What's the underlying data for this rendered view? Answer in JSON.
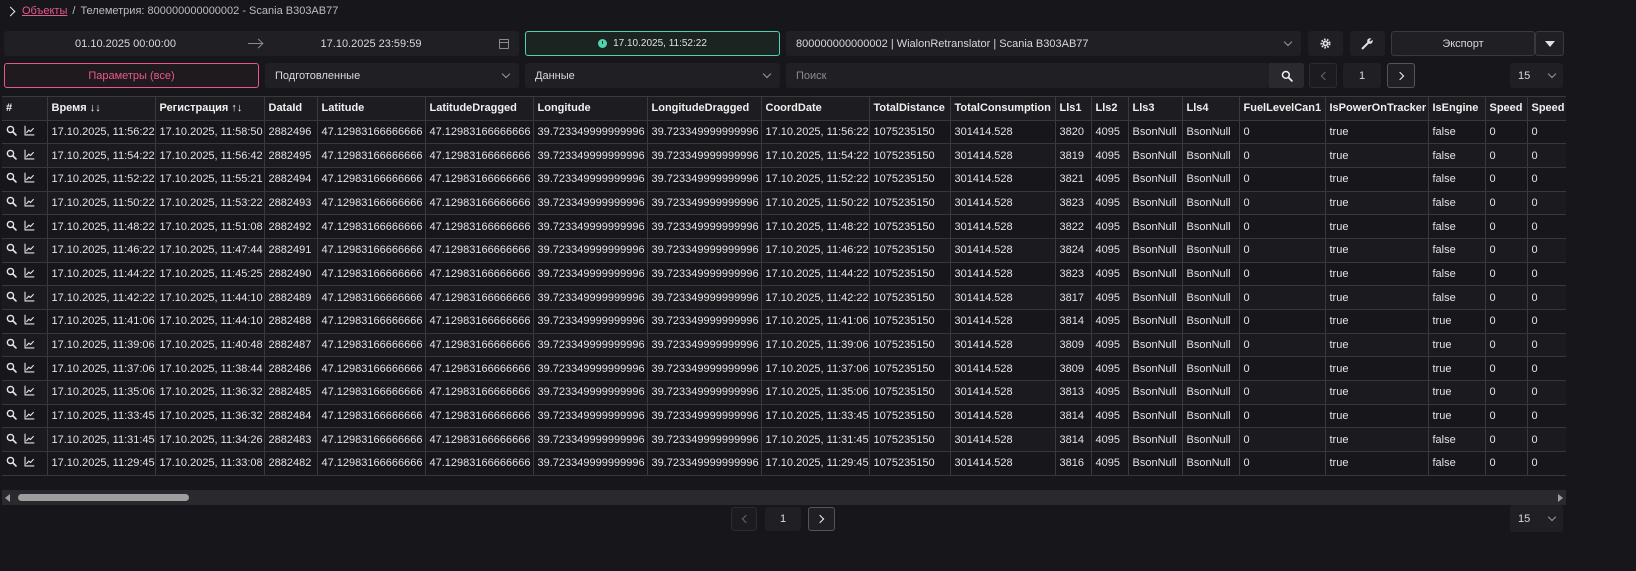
{
  "breadcrumb": {
    "root": "Объекты",
    "separator": "/",
    "current": "Телеметрия: 800000000000002 - Scania В303АВ77"
  },
  "toolbar": {
    "date_from": "01.10.2025 00:00:00",
    "date_to": "17.10.2025 23:59:59",
    "now_button": "17.10.2025, 11:52:22",
    "object_select": "800000000000002 | WialonRetranslator | Scania В303АВ77",
    "export_label": "Экспорт",
    "params_button": "Параметры (все)",
    "prepared_select": "Подготовленные",
    "data_select": "Данные",
    "search_placeholder": "Поиск",
    "page": "1",
    "page_size": "15"
  },
  "colors": {
    "accent_pink": "#e8578f",
    "accent_teal": "#4fd2b0",
    "background": "#17171b"
  },
  "table": {
    "columns": [
      "#",
      "Время ↓↓",
      "Регистрация ↑↓",
      "DataId",
      "Latitude",
      "LatitudeDragged",
      "Longitude",
      "LongitudeDragged",
      "CoordDate",
      "TotalDistance",
      "TotalConsumption",
      "Lls1",
      "Lls2",
      "Lls3",
      "Lls4",
      "FuelLevelCan1",
      "IsPowerOnTracker",
      "IsEngine",
      "Speed",
      "Speed"
    ],
    "rows": [
      [
        "17.10.2025, 11:56:22",
        "17.10.2025, 11:58:50",
        "2882496",
        "47.12983166666666",
        "47.12983166666666",
        "39.723349999999996",
        "39.723349999999996",
        "17.10.2025, 11:56:22",
        "1075235150",
        "301414.528",
        "3820",
        "4095",
        "BsonNull",
        "BsonNull",
        "0",
        "true",
        "false",
        "0",
        "0"
      ],
      [
        "17.10.2025, 11:54:22",
        "17.10.2025, 11:56:42",
        "2882495",
        "47.12983166666666",
        "47.12983166666666",
        "39.723349999999996",
        "39.723349999999996",
        "17.10.2025, 11:54:22",
        "1075235150",
        "301414.528",
        "3819",
        "4095",
        "BsonNull",
        "BsonNull",
        "0",
        "true",
        "false",
        "0",
        "0"
      ],
      [
        "17.10.2025, 11:52:22",
        "17.10.2025, 11:55:21",
        "2882494",
        "47.12983166666666",
        "47.12983166666666",
        "39.723349999999996",
        "39.723349999999996",
        "17.10.2025, 11:52:22",
        "1075235150",
        "301414.528",
        "3821",
        "4095",
        "BsonNull",
        "BsonNull",
        "0",
        "true",
        "false",
        "0",
        "0"
      ],
      [
        "17.10.2025, 11:50:22",
        "17.10.2025, 11:53:22",
        "2882493",
        "47.12983166666666",
        "47.12983166666666",
        "39.723349999999996",
        "39.723349999999996",
        "17.10.2025, 11:50:22",
        "1075235150",
        "301414.528",
        "3823",
        "4095",
        "BsonNull",
        "BsonNull",
        "0",
        "true",
        "false",
        "0",
        "0"
      ],
      [
        "17.10.2025, 11:48:22",
        "17.10.2025, 11:51:08",
        "2882492",
        "47.12983166666666",
        "47.12983166666666",
        "39.723349999999996",
        "39.723349999999996",
        "17.10.2025, 11:48:22",
        "1075235150",
        "301414.528",
        "3822",
        "4095",
        "BsonNull",
        "BsonNull",
        "0",
        "true",
        "false",
        "0",
        "0"
      ],
      [
        "17.10.2025, 11:46:22",
        "17.10.2025, 11:47:44",
        "2882491",
        "47.12983166666666",
        "47.12983166666666",
        "39.723349999999996",
        "39.723349999999996",
        "17.10.2025, 11:46:22",
        "1075235150",
        "301414.528",
        "3824",
        "4095",
        "BsonNull",
        "BsonNull",
        "0",
        "true",
        "false",
        "0",
        "0"
      ],
      [
        "17.10.2025, 11:44:22",
        "17.10.2025, 11:45:25",
        "2882490",
        "47.12983166666666",
        "47.12983166666666",
        "39.723349999999996",
        "39.723349999999996",
        "17.10.2025, 11:44:22",
        "1075235150",
        "301414.528",
        "3823",
        "4095",
        "BsonNull",
        "BsonNull",
        "0",
        "true",
        "false",
        "0",
        "0"
      ],
      [
        "17.10.2025, 11:42:22",
        "17.10.2025, 11:44:10",
        "2882489",
        "47.12983166666666",
        "47.12983166666666",
        "39.723349999999996",
        "39.723349999999996",
        "17.10.2025, 11:42:22",
        "1075235150",
        "301414.528",
        "3817",
        "4095",
        "BsonNull",
        "BsonNull",
        "0",
        "true",
        "false",
        "0",
        "0"
      ],
      [
        "17.10.2025, 11:41:06",
        "17.10.2025, 11:44:10",
        "2882488",
        "47.12983166666666",
        "47.12983166666666",
        "39.723349999999996",
        "39.723349999999996",
        "17.10.2025, 11:41:06",
        "1075235150",
        "301414.528",
        "3814",
        "4095",
        "BsonNull",
        "BsonNull",
        "0",
        "true",
        "true",
        "0",
        "0"
      ],
      [
        "17.10.2025, 11:39:06",
        "17.10.2025, 11:40:48",
        "2882487",
        "47.12983166666666",
        "47.12983166666666",
        "39.723349999999996",
        "39.723349999999996",
        "17.10.2025, 11:39:06",
        "1075235150",
        "301414.528",
        "3809",
        "4095",
        "BsonNull",
        "BsonNull",
        "0",
        "true",
        "true",
        "0",
        "0"
      ],
      [
        "17.10.2025, 11:37:06",
        "17.10.2025, 11:38:44",
        "2882486",
        "47.12983166666666",
        "47.12983166666666",
        "39.723349999999996",
        "39.723349999999996",
        "17.10.2025, 11:37:06",
        "1075235150",
        "301414.528",
        "3809",
        "4095",
        "BsonNull",
        "BsonNull",
        "0",
        "true",
        "true",
        "0",
        "0"
      ],
      [
        "17.10.2025, 11:35:06",
        "17.10.2025, 11:36:32",
        "2882485",
        "47.12983166666666",
        "47.12983166666666",
        "39.723349999999996",
        "39.723349999999996",
        "17.10.2025, 11:35:06",
        "1075235150",
        "301414.528",
        "3813",
        "4095",
        "BsonNull",
        "BsonNull",
        "0",
        "true",
        "true",
        "0",
        "0"
      ],
      [
        "17.10.2025, 11:33:45",
        "17.10.2025, 11:36:32",
        "2882484",
        "47.12983166666666",
        "47.12983166666666",
        "39.723349999999996",
        "39.723349999999996",
        "17.10.2025, 11:33:45",
        "1075235150",
        "301414.528",
        "3814",
        "4095",
        "BsonNull",
        "BsonNull",
        "0",
        "true",
        "true",
        "0",
        "0"
      ],
      [
        "17.10.2025, 11:31:45",
        "17.10.2025, 11:34:26",
        "2882483",
        "47.12983166666666",
        "47.12983166666666",
        "39.723349999999996",
        "39.723349999999996",
        "17.10.2025, 11:31:45",
        "1075235150",
        "301414.528",
        "3814",
        "4095",
        "BsonNull",
        "BsonNull",
        "0",
        "true",
        "false",
        "0",
        "0"
      ],
      [
        "17.10.2025, 11:29:45",
        "17.10.2025, 11:33:08",
        "2882482",
        "47.12983166666666",
        "47.12983166666666",
        "39.723349999999996",
        "39.723349999999996",
        "17.10.2025, 11:29:45",
        "1075235150",
        "301414.528",
        "3816",
        "4095",
        "BsonNull",
        "BsonNull",
        "0",
        "true",
        "false",
        "0",
        "0"
      ]
    ]
  },
  "pagination_bottom": {
    "page": "1",
    "page_size": "15"
  }
}
